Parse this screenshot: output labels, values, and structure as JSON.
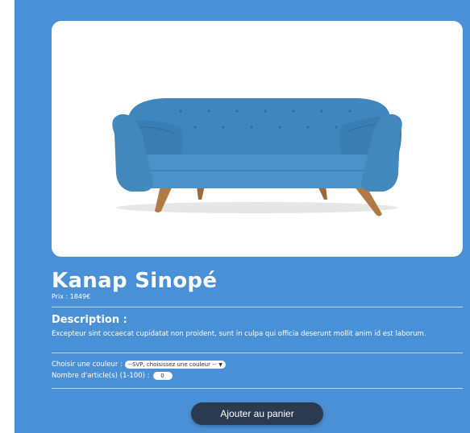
{
  "product": {
    "name": "Kanap Sinopé",
    "price_label": "Prix : ",
    "price": "1849",
    "currency": "€",
    "image_alt_icon": "sofa-image"
  },
  "description": {
    "heading": "Description :",
    "text": "Excepteur sint occaecat cupidatat non proident, sunt in culpa qui officia deserunt mollit anim id est laborum."
  },
  "form": {
    "color_label": "Choisir une couleur : ",
    "color_selected": "--SVP, choisissez une couleur --",
    "quantity_label": "Nombre d'article(s) (1-100) : ",
    "quantity_value": "0"
  },
  "actions": {
    "add_to_cart": "Ajouter au panier"
  },
  "colors": {
    "background": "#4a90d6",
    "button": "#2b3b4f",
    "sofa": "#3f86bd"
  }
}
